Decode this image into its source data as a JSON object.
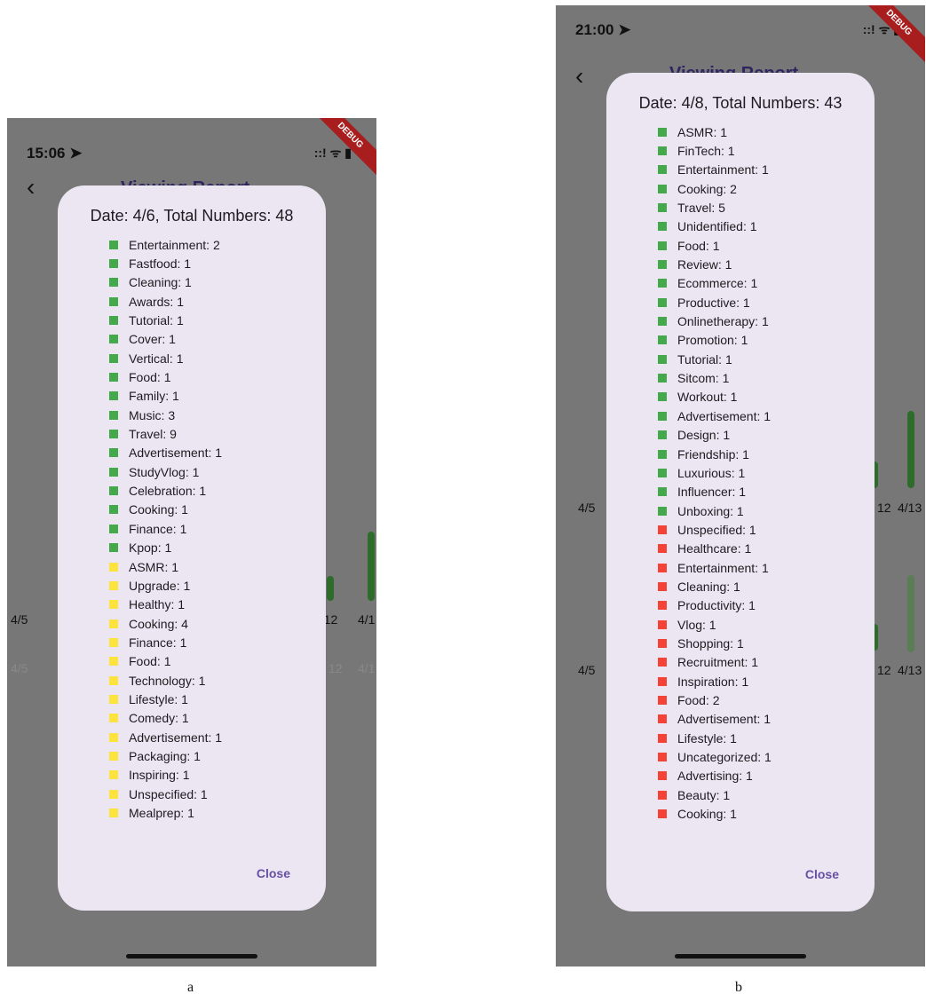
{
  "colors": {
    "green": "#43a94b",
    "yellow": "#fde43c",
    "red": "#f44336",
    "close": "#6750a4"
  },
  "panel_a": {
    "status_time": "15:06 ➤",
    "status_icons": "::! ᯤ ▮",
    "debug": "DEBUG",
    "back_icon": "chevron-left-icon",
    "appbar_title": "Viewing Report",
    "bg_labels_row1": [
      "4/5",
      "4/12",
      "4/1"
    ],
    "bg_labels_row2": [
      "4/5",
      "12",
      "4/1"
    ],
    "dialog_title": "Date: 4/6, Total Numbers: 48",
    "items": [
      {
        "label": "Entertainment: 2",
        "color": "green"
      },
      {
        "label": "Fastfood: 1",
        "color": "green"
      },
      {
        "label": "Cleaning: 1",
        "color": "green"
      },
      {
        "label": "Awards: 1",
        "color": "green"
      },
      {
        "label": "Tutorial: 1",
        "color": "green"
      },
      {
        "label": "Cover: 1",
        "color": "green"
      },
      {
        "label": "Vertical: 1",
        "color": "green"
      },
      {
        "label": "Food: 1",
        "color": "green"
      },
      {
        "label": "Family: 1",
        "color": "green"
      },
      {
        "label": "Music: 3",
        "color": "green"
      },
      {
        "label": "Travel: 9",
        "color": "green"
      },
      {
        "label": "Advertisement: 1",
        "color": "green"
      },
      {
        "label": "StudyVlog: 1",
        "color": "green"
      },
      {
        "label": "Celebration: 1",
        "color": "green"
      },
      {
        "label": "Cooking: 1",
        "color": "green"
      },
      {
        "label": "Finance: 1",
        "color": "green"
      },
      {
        "label": "Kpop: 1",
        "color": "green"
      },
      {
        "label": "ASMR: 1",
        "color": "yellow"
      },
      {
        "label": "Upgrade: 1",
        "color": "yellow"
      },
      {
        "label": "Healthy: 1",
        "color": "yellow"
      },
      {
        "label": "Cooking: 4",
        "color": "yellow"
      },
      {
        "label": "Finance: 1",
        "color": "yellow"
      },
      {
        "label": "Food: 1",
        "color": "yellow"
      },
      {
        "label": "Technology: 1",
        "color": "yellow"
      },
      {
        "label": "Lifestyle: 1",
        "color": "yellow"
      },
      {
        "label": "Comedy: 1",
        "color": "yellow"
      },
      {
        "label": "Advertisement: 1",
        "color": "yellow"
      },
      {
        "label": "Packaging: 1",
        "color": "yellow"
      },
      {
        "label": "Inspiring: 1",
        "color": "yellow"
      },
      {
        "label": "Unspecified: 1",
        "color": "yellow"
      },
      {
        "label": "Mealprep: 1",
        "color": "yellow"
      }
    ],
    "close_label": "Close",
    "caption": "a"
  },
  "panel_b": {
    "status_time": "21:00 ➤",
    "status_icons": "::! ᯤ ▮",
    "debug": "DEBUG",
    "back_icon": "chevron-left-icon",
    "appbar_title": "Viewing Report",
    "bg_labels_row1": [
      "4/5",
      "12",
      "4/13"
    ],
    "bg_labels_row2": [
      "4/5",
      "12",
      "4/13"
    ],
    "dialog_title": "Date: 4/8, Total Numbers: 43",
    "items": [
      {
        "label": "ASMR: 1",
        "color": "green"
      },
      {
        "label": "FinTech: 1",
        "color": "green"
      },
      {
        "label": "Entertainment: 1",
        "color": "green"
      },
      {
        "label": "Cooking: 2",
        "color": "green"
      },
      {
        "label": "Travel: 5",
        "color": "green"
      },
      {
        "label": "Unidentified: 1",
        "color": "green"
      },
      {
        "label": "Food: 1",
        "color": "green"
      },
      {
        "label": "Review: 1",
        "color": "green"
      },
      {
        "label": "Ecommerce: 1",
        "color": "green"
      },
      {
        "label": "Productive: 1",
        "color": "green"
      },
      {
        "label": "Onlinetherapy: 1",
        "color": "green"
      },
      {
        "label": "Promotion: 1",
        "color": "green"
      },
      {
        "label": "Tutorial: 1",
        "color": "green"
      },
      {
        "label": "Sitcom: 1",
        "color": "green"
      },
      {
        "label": "Workout: 1",
        "color": "green"
      },
      {
        "label": "Advertisement: 1",
        "color": "green"
      },
      {
        "label": "Design: 1",
        "color": "green"
      },
      {
        "label": "Friendship: 1",
        "color": "green"
      },
      {
        "label": "Luxurious: 1",
        "color": "green"
      },
      {
        "label": "Influencer: 1",
        "color": "green"
      },
      {
        "label": "Unboxing: 1",
        "color": "green"
      },
      {
        "label": "Unspecified: 1",
        "color": "red"
      },
      {
        "label": "Healthcare: 1",
        "color": "red"
      },
      {
        "label": "Entertainment: 1",
        "color": "red"
      },
      {
        "label": "Cleaning: 1",
        "color": "red"
      },
      {
        "label": "Productivity: 1",
        "color": "red"
      },
      {
        "label": "Vlog: 1",
        "color": "red"
      },
      {
        "label": "Shopping: 1",
        "color": "red"
      },
      {
        "label": "Recruitment: 1",
        "color": "red"
      },
      {
        "label": "Inspiration: 1",
        "color": "red"
      },
      {
        "label": "Food: 2",
        "color": "red"
      },
      {
        "label": "Advertisement: 1",
        "color": "red"
      },
      {
        "label": "Lifestyle: 1",
        "color": "red"
      },
      {
        "label": "Uncategorized: 1",
        "color": "red"
      },
      {
        "label": "Advertising: 1",
        "color": "red"
      },
      {
        "label": "Beauty: 1",
        "color": "red"
      },
      {
        "label": "Cooking: 1",
        "color": "red"
      }
    ],
    "close_label": "Close",
    "caption": "b"
  }
}
